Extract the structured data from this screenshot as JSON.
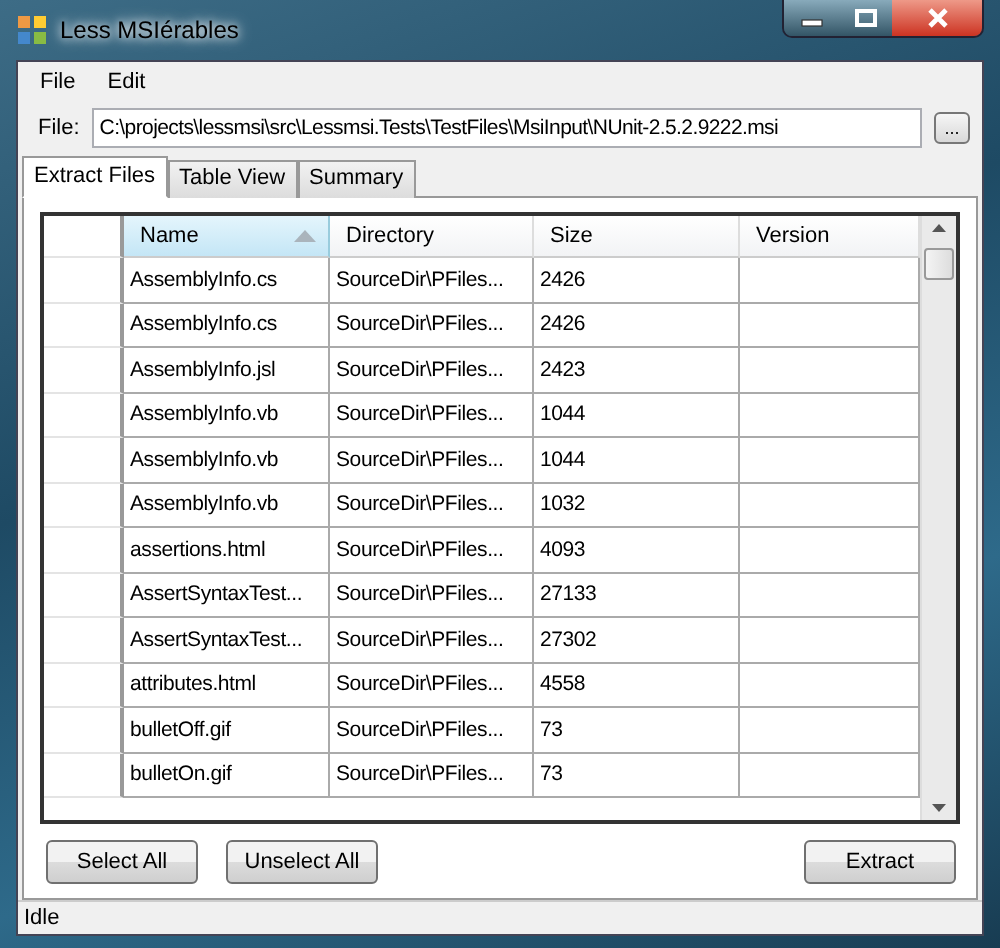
{
  "window": {
    "title": "Less MSIérables"
  },
  "menu": [
    "File",
    "Edit"
  ],
  "file_field": {
    "label": "File:",
    "value": "C:\\projects\\lessmsi\\src\\Lessmsi.Tests\\TestFiles\\MsiInput\\NUnit-2.5.2.9222.msi",
    "browse": "..."
  },
  "tabs": [
    {
      "label": "Extract Files",
      "selected": true
    },
    {
      "label": "Table View",
      "selected": false
    },
    {
      "label": "Summary",
      "selected": false
    }
  ],
  "table": {
    "columns": [
      {
        "label": "Name",
        "sorted": true
      },
      {
        "label": "Directory",
        "sorted": false
      },
      {
        "label": "Size",
        "sorted": false
      },
      {
        "label": "Version",
        "sorted": false
      }
    ],
    "rows": [
      [
        "AssemblyInfo.cs",
        "SourceDir\\PFiles...",
        "2426"
      ],
      [
        "AssemblyInfo.cs",
        "SourceDir\\PFiles...",
        "2426"
      ],
      [
        "AssemblyInfo.jsl",
        "SourceDir\\PFiles...",
        "2423"
      ],
      [
        "AssemblyInfo.vb",
        "SourceDir\\PFiles...",
        "1044"
      ],
      [
        "AssemblyInfo.vb",
        "SourceDir\\PFiles...",
        "1044"
      ],
      [
        "AssemblyInfo.vb",
        "SourceDir\\PFiles...",
        "1032"
      ],
      [
        "assertions.html",
        "SourceDir\\PFiles...",
        "4093"
      ],
      [
        "AssertSyntaxTest...",
        "SourceDir\\PFiles...",
        "27133"
      ],
      [
        "AssertSyntaxTest...",
        "SourceDir\\PFiles...",
        "27302"
      ],
      [
        "attributes.html",
        "SourceDir\\PFiles...",
        "4558"
      ],
      [
        "bulletOff.gif",
        "SourceDir\\PFiles...",
        "73"
      ],
      [
        "bulletOn.gif",
        "SourceDir\\PFiles...",
        "73"
      ]
    ]
  },
  "buttons": {
    "left": [
      "Select All",
      "Unselect All"
    ],
    "right": "Extract"
  },
  "status_bar": "Idle"
}
